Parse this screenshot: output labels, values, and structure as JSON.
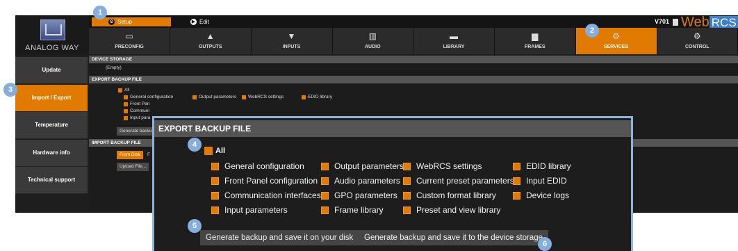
{
  "brand": {
    "name": "ANALOG WAY"
  },
  "topbar": {
    "setup_label": "Setup",
    "edit_label": "Edit",
    "version": "V701",
    "web": "Web",
    "rcs": "RCS",
    "close": "×"
  },
  "nav": [
    {
      "label": "PRECONFIG",
      "icon": "preconfig-icon",
      "glyph": "▭"
    },
    {
      "label": "OUTPUTS",
      "icon": "outputs-icon",
      "glyph": "▲"
    },
    {
      "label": "INPUTS",
      "icon": "inputs-icon",
      "glyph": "▼"
    },
    {
      "label": "AUDIO",
      "icon": "audio-icon",
      "glyph": "▥"
    },
    {
      "label": "LIBRARY",
      "icon": "library-icon",
      "glyph": "▬"
    },
    {
      "label": "FRAMES",
      "icon": "frames-icon",
      "glyph": "▆"
    },
    {
      "label": "SERVICES",
      "icon": "services-icon",
      "glyph": "⚙"
    },
    {
      "label": "CONTROL",
      "icon": "control-icon",
      "glyph": "⚙"
    }
  ],
  "nav_active_index": 6,
  "sidebar": [
    {
      "label": "Update"
    },
    {
      "label": "Import / Export"
    },
    {
      "label": "Temperature"
    },
    {
      "label": "Hardware info"
    },
    {
      "label": "Technical support"
    }
  ],
  "main": {
    "device_storage_header": "DEVICE STORAGE",
    "device_storage_value": "(Empty)",
    "export_header": "EXPORT BACKUP FILE",
    "import_header": "IMPORT BACKUP FILE",
    "small_all": "All",
    "small_opts": [
      "General configuration",
      "Output parameters",
      "WebRCS settings",
      "EDID library"
    ],
    "small_col1": [
      "Front Pan",
      "Communi",
      "Input para"
    ],
    "small_generate": "Generate backu",
    "from_disk": "From Disk",
    "from_disk_suffix": "F",
    "upload_file": "Upload File..."
  },
  "overlay": {
    "header": "EXPORT BACKUP FILE",
    "all_label": "All",
    "options": [
      [
        "General configuration",
        "Output parameters",
        "WebRCS settings",
        "EDID library"
      ],
      [
        "Front Panel configuration",
        "Audio parameters",
        "Current preset parameters",
        "Input EDID"
      ],
      [
        "Communication interfaces",
        "GPO parameters",
        "Custom format library",
        "Device logs"
      ],
      [
        "Input parameters",
        "Frame library",
        "Preset and view library"
      ]
    ],
    "btn_disk": "Generate backup and save it on your disk",
    "btn_device": "Generate backup and save it to the device storage"
  },
  "callouts": [
    "1",
    "2",
    "3",
    "4",
    "5",
    "6"
  ],
  "colors": {
    "accent": "#e07b00",
    "callout": "#86aedc",
    "overlay_border": "#8cb5e0"
  }
}
